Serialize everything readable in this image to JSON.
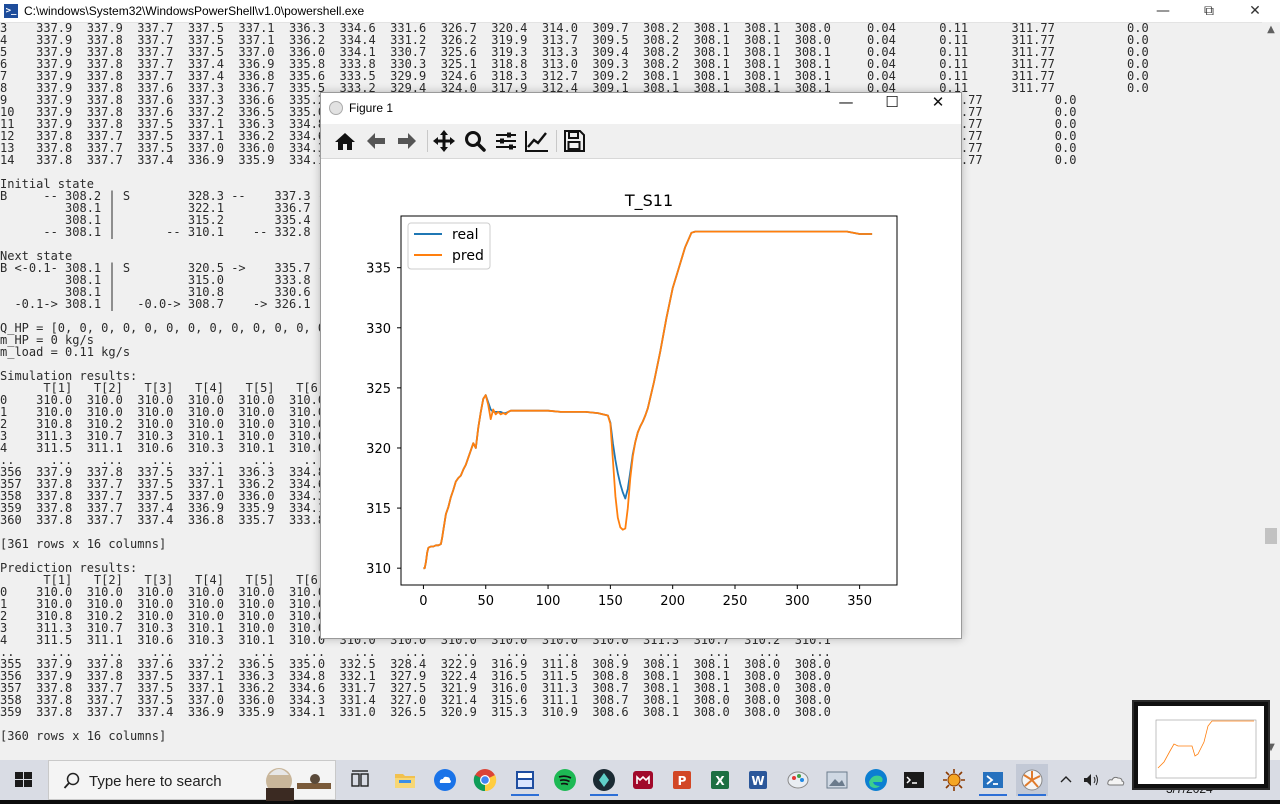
{
  "powershell": {
    "title": "C:\\windows\\System32\\WindowsPowerShell\\v1.0\\powershell.exe",
    "console_lines": [
      "3    337.9  337.9  337.7  337.5  337.1  336.3  334.6  331.6  326.7  320.4  314.0  309.7  308.2  308.1  308.1  308.0     0.04      0.11      311.77          0.0",
      "4    337.9  337.8  337.7  337.5  337.1  336.2  334.4  331.2  326.2  319.9  313.7  309.5  308.2  308.1  308.1  308.0     0.04      0.11      311.77          0.0",
      "5    337.9  337.8  337.7  337.5  337.0  336.0  334.1  330.7  325.6  319.3  313.3  309.4  308.2  308.1  308.1  308.1     0.04      0.11      311.77          0.0",
      "6    337.9  337.8  337.7  337.4  336.9  335.8  333.8  330.3  325.1  318.8  313.0  309.3  308.2  308.1  308.1  308.1     0.04      0.11      311.77          0.0",
      "7    337.9  337.8  337.7  337.4  336.8  335.6  333.5  329.9  324.6  318.3  312.7  309.2  308.1  308.1  308.1  308.1     0.04      0.11      311.77          0.0",
      "8    337.9  337.8  337.6  337.3  336.7  335.5  333.2  329.4  324.0  317.9  312.4  309.1  308.1  308.1  308.1  308.1     0.04      0.11      311.77          0.0",
      "9    337.9  337.8  337.6  337.3  336.6  335.2                                                                                        .77          0.0",
      "10   337.9  337.8  337.6  337.2  336.5  335.0                                                                                        .77          0.0",
      "11   337.9  337.8  337.5  337.1  336.3  334.8                                                                                        .77          0.0",
      "12   337.8  337.7  337.5  337.1  336.2  334.6                                                                                        .77          0.0",
      "13   337.8  337.7  337.5  337.0  336.0  334.3                                                                                        .77          0.0",
      "14   337.8  337.7  337.4  336.9  335.9  334.1                                                                                        .77          0.0",
      "",
      "Initial state",
      "B     -- 308.2 | S        328.3 --    337.3 --",
      "         308.1 |          322.1       336.7",
      "         308.1 |          315.2       335.4",
      "      -- 308.1 |       -- 310.1    -- 332.8",
      "",
      "Next state",
      "B <-0.1- 308.1 | S        320.5 ->    335.7 ->",
      "         308.1 |          315.0       333.8",
      "         308.1 |          310.8       330.6",
      "  -0.1-> 308.1 |   -0.0-> 308.7    -> 326.1",
      "",
      "Q_HP = [0, 0, 0, 0, 0, 0, 0, 0, 0, 0, 0, 0, 0,",
      "m_HP = 0 kg/s",
      "m_load = 0.11 kg/s",
      "",
      "Simulation results:",
      "      T[1]   T[2]   T[3]   T[4]   T[5]   T[6]",
      "0    310.0  310.0  310.0  310.0  310.0  310.0",
      "1    310.0  310.0  310.0  310.0  310.0  310.0",
      "2    310.8  310.2  310.0  310.0  310.0  310.0",
      "3    311.3  310.7  310.3  310.1  310.0  310.0",
      "4    311.5  311.1  310.6  310.3  310.1  310.0",
      "..     ...    ...    ...    ...    ...    ...",
      "356  337.9  337.8  337.5  337.1  336.3  334.8",
      "357  337.8  337.7  337.5  337.1  336.2  334.6",
      "358  337.8  337.7  337.5  337.0  336.0  334.3",
      "359  337.8  337.7  337.4  336.9  335.9  334.1",
      "360  337.8  337.7  337.4  336.8  335.7  333.8",
      "",
      "[361 rows x 16 columns]",
      "",
      "Prediction results:",
      "      T[1]   T[2]   T[3]   T[4]   T[5]   T[6]",
      "0    310.0  310.0  310.0  310.0  310.0  310.0",
      "1    310.0  310.0  310.0  310.0  310.0  310.0",
      "2    310.8  310.2  310.0  310.0  310.0  310.0",
      "3    311.3  310.7  310.3  310.1  310.0  310.0",
      "4    311.5  311.1  310.6  310.3  310.1  310.0  310.0  310.0  310.0  310.0  310.0  310.0  311.3  310.7  310.2  310.1",
      "..     ...    ...    ...    ...    ...    ...    ...    ...    ...    ...    ...    ...    ...    ...    ...    ...",
      "355  337.9  337.8  337.6  337.2  336.5  335.0  332.5  328.4  322.9  316.9  311.8  308.9  308.1  308.1  308.0  308.0",
      "356  337.9  337.8  337.5  337.1  336.3  334.8  332.1  327.9  322.4  316.5  311.5  308.8  308.1  308.1  308.0  308.0",
      "357  337.8  337.7  337.5  337.1  336.2  334.6  331.7  327.5  321.9  316.0  311.3  308.7  308.1  308.1  308.0  308.0",
      "358  337.8  337.7  337.5  337.0  336.0  334.3  331.4  327.0  321.4  315.6  311.1  308.7  308.1  308.0  308.0  308.0",
      "359  337.8  337.7  337.4  336.9  335.9  334.1  331.0  326.5  320.9  315.3  310.9  308.6  308.1  308.0  308.0  308.0",
      "",
      "[360 rows x 16 columns]"
    ]
  },
  "figure": {
    "window_title": "Figure 1",
    "toolbar": [
      "home-icon",
      "back-icon",
      "forward-icon",
      "pan-icon",
      "zoom-icon",
      "configure-subplots-icon",
      "edit-axis-icon",
      "save-icon"
    ]
  },
  "chart_data": {
    "type": "line",
    "title": "T_S11",
    "xlabel": "",
    "ylabel": "",
    "xlim": [
      -18,
      380
    ],
    "ylim": [
      308.6,
      339.3
    ],
    "xticks": [
      0,
      50,
      100,
      150,
      200,
      250,
      300,
      350
    ],
    "yticks": [
      310,
      315,
      320,
      325,
      330,
      335
    ],
    "legend": "upper-left",
    "series": [
      {
        "name": "real",
        "color": "#1f77b4",
        "x": [
          0,
          1,
          2,
          3,
          4,
          6,
          8,
          10,
          12,
          14,
          15,
          16,
          18,
          20,
          22,
          24,
          26,
          28,
          30,
          32,
          34,
          36,
          38,
          40,
          42,
          44,
          46,
          48,
          50,
          52,
          54,
          56,
          58,
          60,
          62,
          64,
          66,
          68,
          70,
          75,
          80,
          90,
          100,
          110,
          120,
          130,
          140,
          148,
          150,
          152,
          154,
          156,
          158,
          160,
          162,
          164,
          166,
          168,
          170,
          172,
          174,
          176,
          178,
          180,
          185,
          190,
          195,
          200,
          205,
          210,
          215,
          218,
          220,
          225,
          230,
          250,
          280,
          300,
          320,
          340,
          350,
          355,
          360
        ],
        "y": [
          310.0,
          310.0,
          310.5,
          311.3,
          311.7,
          311.8,
          311.8,
          311.9,
          311.9,
          312.0,
          312.5,
          313.2,
          314.5,
          315.1,
          315.9,
          316.5,
          317.2,
          317.5,
          317.7,
          318.2,
          318.6,
          319.2,
          319.8,
          320.4,
          320.0,
          321.7,
          323.0,
          324.1,
          324.4,
          323.8,
          323.2,
          323.0,
          323.0,
          323.0,
          323.0,
          322.9,
          322.9,
          323.0,
          323.1,
          323.1,
          323.1,
          323.1,
          323.1,
          323.0,
          323.0,
          323.0,
          322.9,
          322.7,
          322.1,
          320.4,
          319.0,
          317.9,
          317.0,
          316.3,
          315.8,
          316.6,
          318.0,
          319.5,
          320.5,
          321.3,
          321.8,
          322.2,
          322.7,
          323.3,
          325.5,
          328.0,
          330.8,
          333.3,
          335.0,
          336.7,
          337.9,
          338.0,
          338.0,
          338.0,
          338.0,
          338.0,
          338.0,
          338.0,
          338.0,
          338.0,
          337.8,
          337.8,
          337.8
        ]
      },
      {
        "name": "pred",
        "color": "#ff7f0e",
        "x": [
          0,
          1,
          2,
          3,
          4,
          6,
          8,
          10,
          12,
          14,
          15,
          16,
          18,
          20,
          22,
          24,
          26,
          28,
          30,
          32,
          34,
          36,
          38,
          40,
          42,
          44,
          46,
          48,
          50,
          52,
          54,
          56,
          58,
          60,
          62,
          64,
          66,
          68,
          70,
          75,
          80,
          90,
          100,
          110,
          120,
          130,
          140,
          148,
          150,
          152,
          154,
          156,
          158,
          160,
          162,
          164,
          166,
          168,
          170,
          172,
          174,
          176,
          178,
          180,
          185,
          190,
          195,
          200,
          205,
          210,
          215,
          218,
          220,
          225,
          230,
          250,
          280,
          300,
          320,
          340,
          350,
          355,
          360
        ],
        "y": [
          310.0,
          310.0,
          310.5,
          311.3,
          311.7,
          311.8,
          311.8,
          311.9,
          311.9,
          312.0,
          312.5,
          313.2,
          314.5,
          315.1,
          315.9,
          316.5,
          317.2,
          317.5,
          317.7,
          318.2,
          318.6,
          319.2,
          319.8,
          320.4,
          320.0,
          321.7,
          323.0,
          324.1,
          324.4,
          323.6,
          322.4,
          323.2,
          322.8,
          323.0,
          322.8,
          322.9,
          322.8,
          323.0,
          323.1,
          323.1,
          323.1,
          323.1,
          323.1,
          323.0,
          323.0,
          323.0,
          322.9,
          322.7,
          322.0,
          319.0,
          316.0,
          314.2,
          313.4,
          313.2,
          313.3,
          315.0,
          317.5,
          319.3,
          320.5,
          321.3,
          321.8,
          322.2,
          322.7,
          323.3,
          325.5,
          328.0,
          330.8,
          333.3,
          335.0,
          336.7,
          337.9,
          338.0,
          338.0,
          338.0,
          338.0,
          338.0,
          338.0,
          338.0,
          338.0,
          338.0,
          337.8,
          337.8,
          337.8
        ]
      }
    ]
  },
  "taskbar": {
    "search_placeholder": "Type here to search",
    "date": "3/7/2024",
    "pinned": [
      "task-view-icon",
      "file-explorer-icon",
      "cloud-app-icon",
      "chrome-icon",
      "calculator-app-icon",
      "spotify-icon",
      "dark-app-icon",
      "mendeley-icon",
      "powerpoint-icon",
      "excel-icon",
      "word-icon",
      "paint-icon",
      "photos-icon",
      "edge-icon",
      "terminal-icon",
      "sun-app-icon",
      "powershell-icon",
      "python-figure-icon"
    ]
  }
}
